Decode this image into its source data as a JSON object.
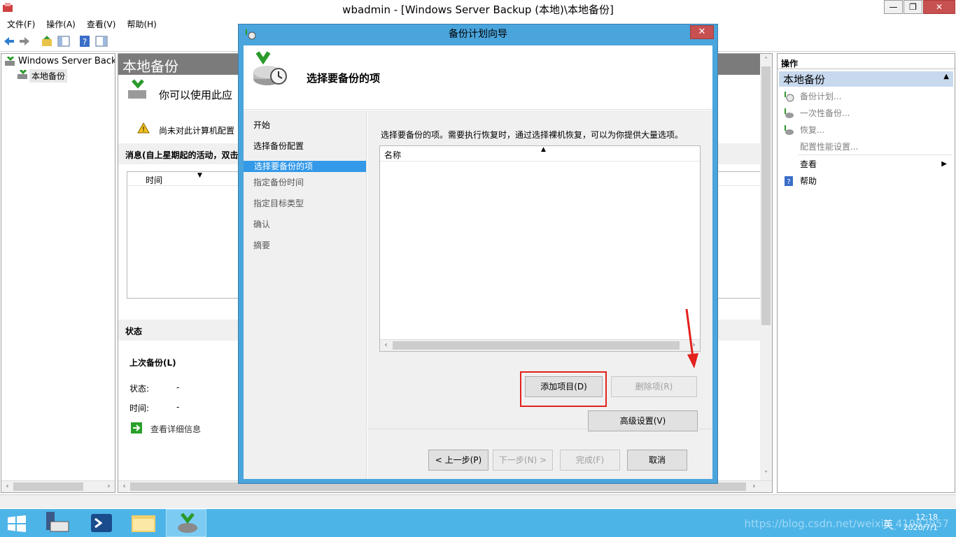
{
  "window": {
    "title": "wbadmin - [Windows Server Backup (本地)\\本地备份]",
    "minimize": "—",
    "restore": "❐",
    "close": "✕"
  },
  "menu": [
    "文件(F)",
    "操作(A)",
    "查看(V)",
    "帮助(H)"
  ],
  "tree": {
    "root": "Windows Server Backup",
    "child": "本地备份"
  },
  "middle": {
    "header": "本地备份",
    "intro": "你可以使用此应",
    "warning": "尚未对此计算机配置",
    "messages_title": "消息(自上星期起的活动，双击",
    "column_time": "时间",
    "status_title": "状态",
    "last_backup": "上次备份(L)",
    "status_label": "状态:",
    "status_value": "-",
    "time_label": "时间:",
    "time_value": "-",
    "details_link": "查看详细信息"
  },
  "actions": {
    "header": "操作",
    "subheader": "本地备份",
    "items": [
      "备份计划...",
      "一次性备份...",
      "恢复...",
      "配置性能设置...",
      "查看",
      "帮助"
    ]
  },
  "dialog": {
    "title": "备份计划向导",
    "close": "✕",
    "heading": "选择要备份的项",
    "steps": [
      "开始",
      "选择备份配置",
      "选择要备份的项",
      "指定备份时间",
      "指定目标类型",
      "确认",
      "摘要"
    ],
    "active_step": 2,
    "intro": "选择要备份的项。需要执行恢复时，通过选择裸机恢复，可以为你提供大量选项。",
    "column_name": "名称",
    "buttons": {
      "add": "添加项目(D)",
      "remove": "删除项(R)",
      "advanced": "高级设置(V)",
      "prev": "< 上一步(P)",
      "next": "下一步(N) >",
      "finish": "完成(F)",
      "cancel": "取消"
    }
  },
  "clock": {
    "time": "12:18",
    "date": "2020/7/1"
  },
  "tray": {
    "ime": "英"
  },
  "watermark": "https://blog.csdn.net/weixin_41982957",
  "colors": {
    "taskbar": "#4db4e8",
    "dialog_frame": "#4aa5dc",
    "active_step": "#3399e8",
    "highlight_box": "#e3211c"
  }
}
